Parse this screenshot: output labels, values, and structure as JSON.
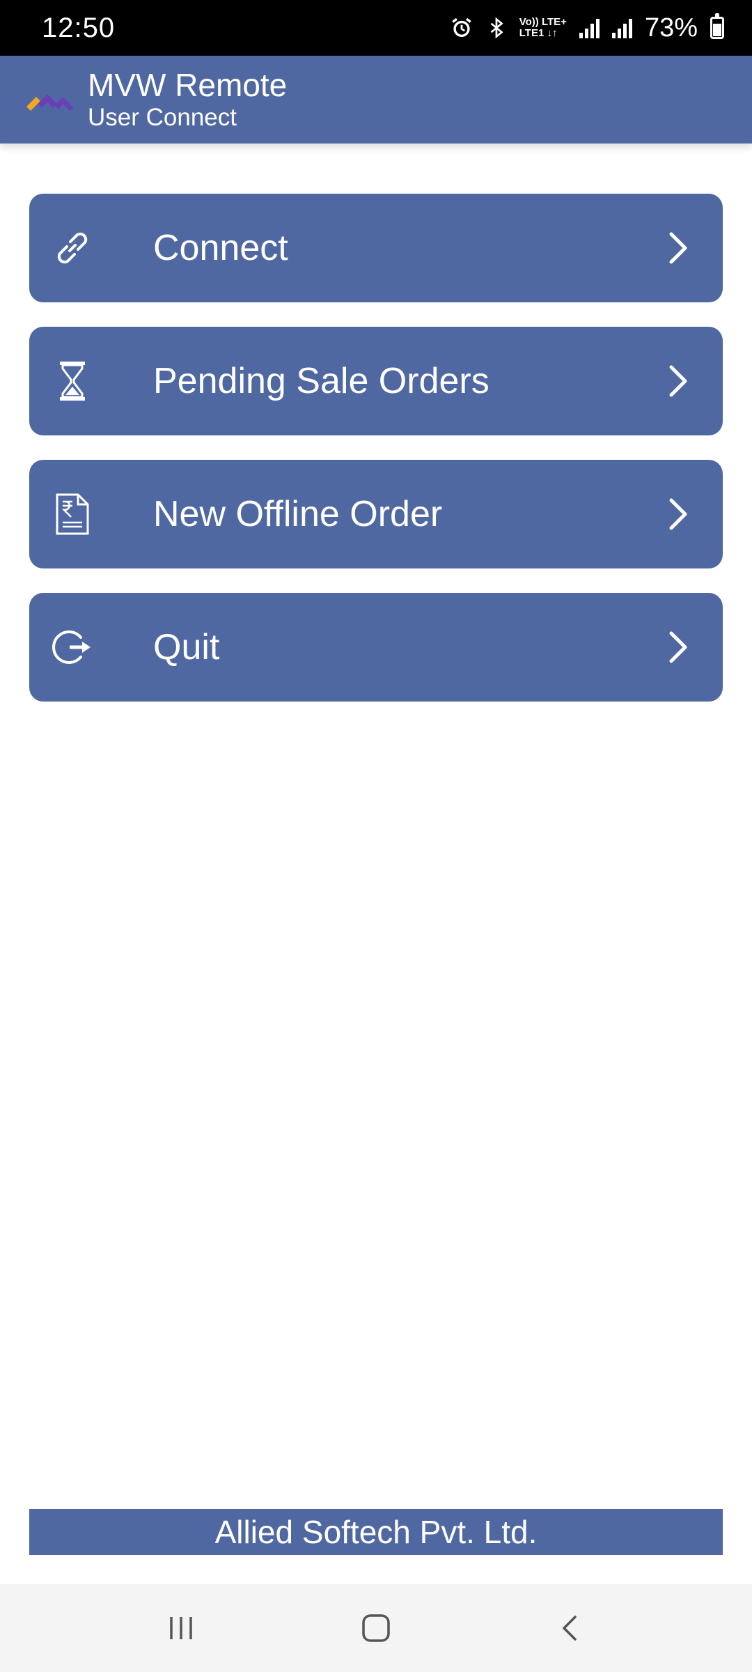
{
  "status_bar": {
    "time": "12:50",
    "network_top": "Vo)) LTE+",
    "network_bottom": "LTE1 ↓↑",
    "battery": "73%",
    "icons": [
      "alarm-icon",
      "bluetooth-icon",
      "signal-icon",
      "battery-icon"
    ]
  },
  "app_bar": {
    "title": "MVW Remote",
    "subtitle": "User Connect"
  },
  "menu": [
    {
      "label": "Connect",
      "icon": "link-icon"
    },
    {
      "label": "Pending Sale Orders",
      "icon": "hourglass-icon"
    },
    {
      "label": "New Offline Order",
      "icon": "rupee-document-icon"
    },
    {
      "label": "Quit",
      "icon": "logout-icon"
    }
  ],
  "footer": {
    "text": "Allied Softech Pvt. Ltd."
  },
  "colors": {
    "primary": "#5068a2",
    "status_bar": "#000000",
    "nav_bar": "#f4f4f4"
  }
}
